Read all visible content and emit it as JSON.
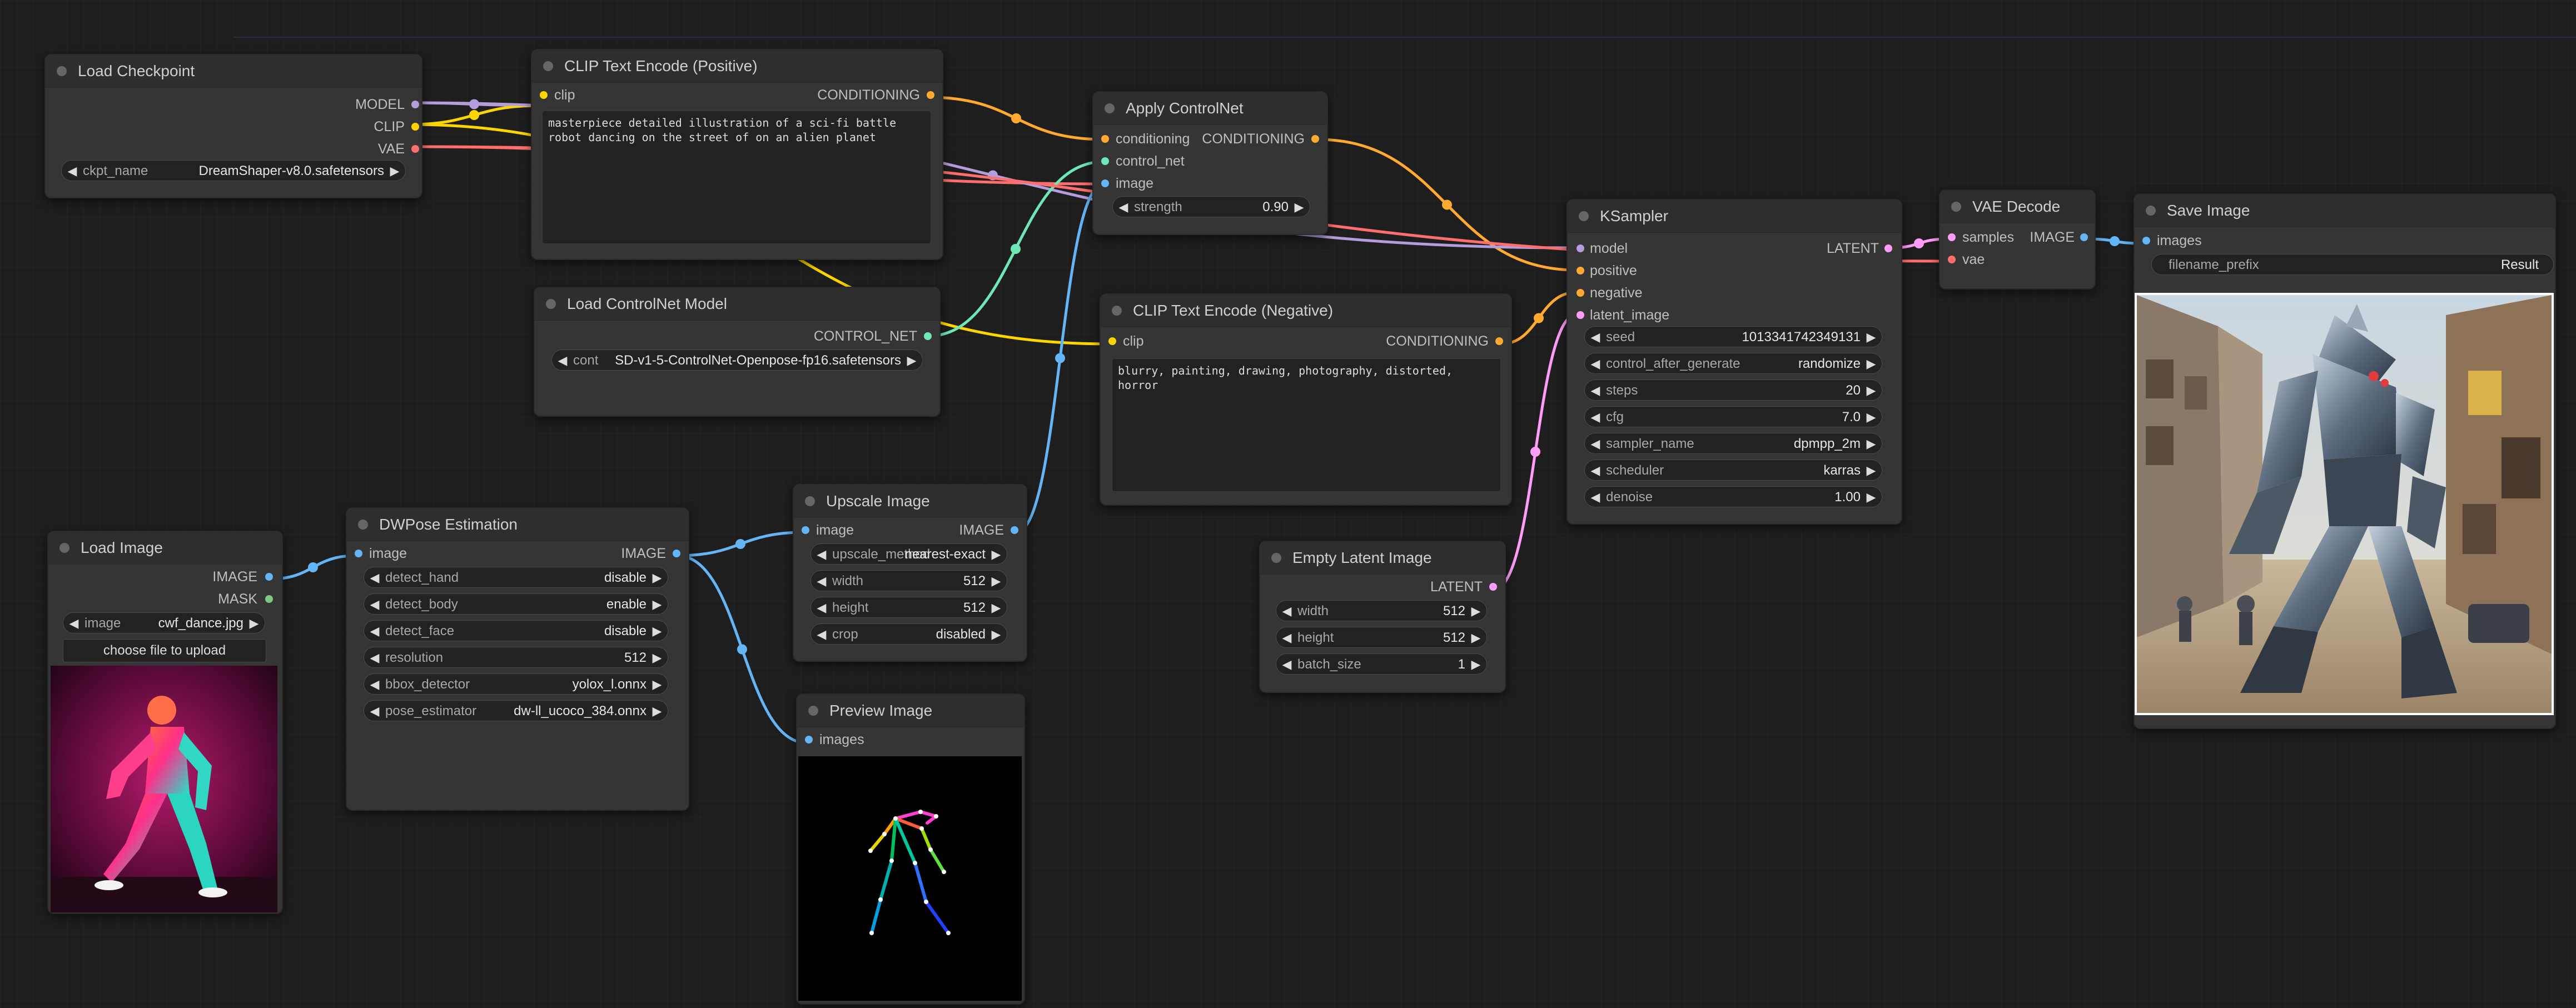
{
  "colors": {
    "model": "#b39ddb",
    "clip": "#ffd500",
    "vae": "#ff6e6e",
    "conditioning": "#ffa931",
    "control_net": "#6ee7b7",
    "image": "#64b5f6",
    "latent": "#ff9cf9",
    "mask": "#81c784"
  },
  "nodes": {
    "load_checkpoint": {
      "title": "Load Checkpoint",
      "outputs": [
        "MODEL",
        "CLIP",
        "VAE"
      ],
      "ckpt_label": "ckpt_name",
      "ckpt_value": "DreamShaper-v8.0.safetensors"
    },
    "clip_pos": {
      "title": "CLIP Text Encode (Positive)",
      "input": "clip",
      "output": "CONDITIONING",
      "text": "masterpiece detailed illustration of a sci-fi battle\nrobot dancing on the street of on an alien planet"
    },
    "apply_controlnet": {
      "title": "Apply ControlNet",
      "inputs": [
        "conditioning",
        "control_net",
        "image"
      ],
      "output": "CONDITIONING",
      "strength_label": "strength",
      "strength_value": "0.90"
    },
    "load_controlnet": {
      "title": "Load ControlNet Model",
      "output": "CONTROL_NET",
      "name_label": "cont",
      "name_value": "SD-v1-5-ControlNet-Openpose-fp16.safetensors"
    },
    "clip_neg": {
      "title": "CLIP Text Encode (Negative)",
      "input": "clip",
      "output": "CONDITIONING",
      "text": "blurry, painting, drawing, photography, distorted, horror"
    },
    "ksampler": {
      "title": "KSampler",
      "inputs": [
        "model",
        "positive",
        "negative",
        "latent_image"
      ],
      "output": "LATENT",
      "widgets": [
        {
          "label": "seed",
          "value": "1013341742349131"
        },
        {
          "label": "control_after_generate",
          "value": "randomize"
        },
        {
          "label": "steps",
          "value": "20"
        },
        {
          "label": "cfg",
          "value": "7.0"
        },
        {
          "label": "sampler_name",
          "value": "dpmpp_2m"
        },
        {
          "label": "scheduler",
          "value": "karras"
        },
        {
          "label": "denoise",
          "value": "1.00"
        }
      ]
    },
    "vae_decode": {
      "title": "VAE Decode",
      "inputs": [
        "samples",
        "vae"
      ],
      "output": "IMAGE"
    },
    "save_image": {
      "title": "Save Image",
      "input": "images",
      "prefix_label": "filename_prefix",
      "prefix_value": "Result"
    },
    "load_image": {
      "title": "Load Image",
      "outputs": [
        "IMAGE",
        "MASK"
      ],
      "image_label": "image",
      "image_value": "cwf_dance.jpg",
      "upload_label": "choose file to upload"
    },
    "dwpose": {
      "title": "DWPose Estimation",
      "input": "image",
      "output": "IMAGE",
      "widgets": [
        {
          "label": "detect_hand",
          "value": "disable"
        },
        {
          "label": "detect_body",
          "value": "enable"
        },
        {
          "label": "detect_face",
          "value": "disable"
        },
        {
          "label": "resolution",
          "value": "512"
        },
        {
          "label": "bbox_detector",
          "value": "yolox_l.onnx"
        },
        {
          "label": "pose_estimator",
          "value": "dw-ll_ucoco_384.onnx"
        }
      ]
    },
    "upscale": {
      "title": "Upscale Image",
      "input": "image",
      "output": "IMAGE",
      "widgets": [
        {
          "label": "upscale_method",
          "value": "nearest-exact"
        },
        {
          "label": "width",
          "value": "512"
        },
        {
          "label": "height",
          "value": "512"
        },
        {
          "label": "crop",
          "value": "disabled"
        }
      ]
    },
    "preview": {
      "title": "Preview Image",
      "input": "images"
    },
    "empty_latent": {
      "title": "Empty Latent Image",
      "output": "LATENT",
      "widgets": [
        {
          "label": "width",
          "value": "512"
        },
        {
          "label": "height",
          "value": "512"
        },
        {
          "label": "batch_size",
          "value": "1"
        }
      ]
    }
  }
}
